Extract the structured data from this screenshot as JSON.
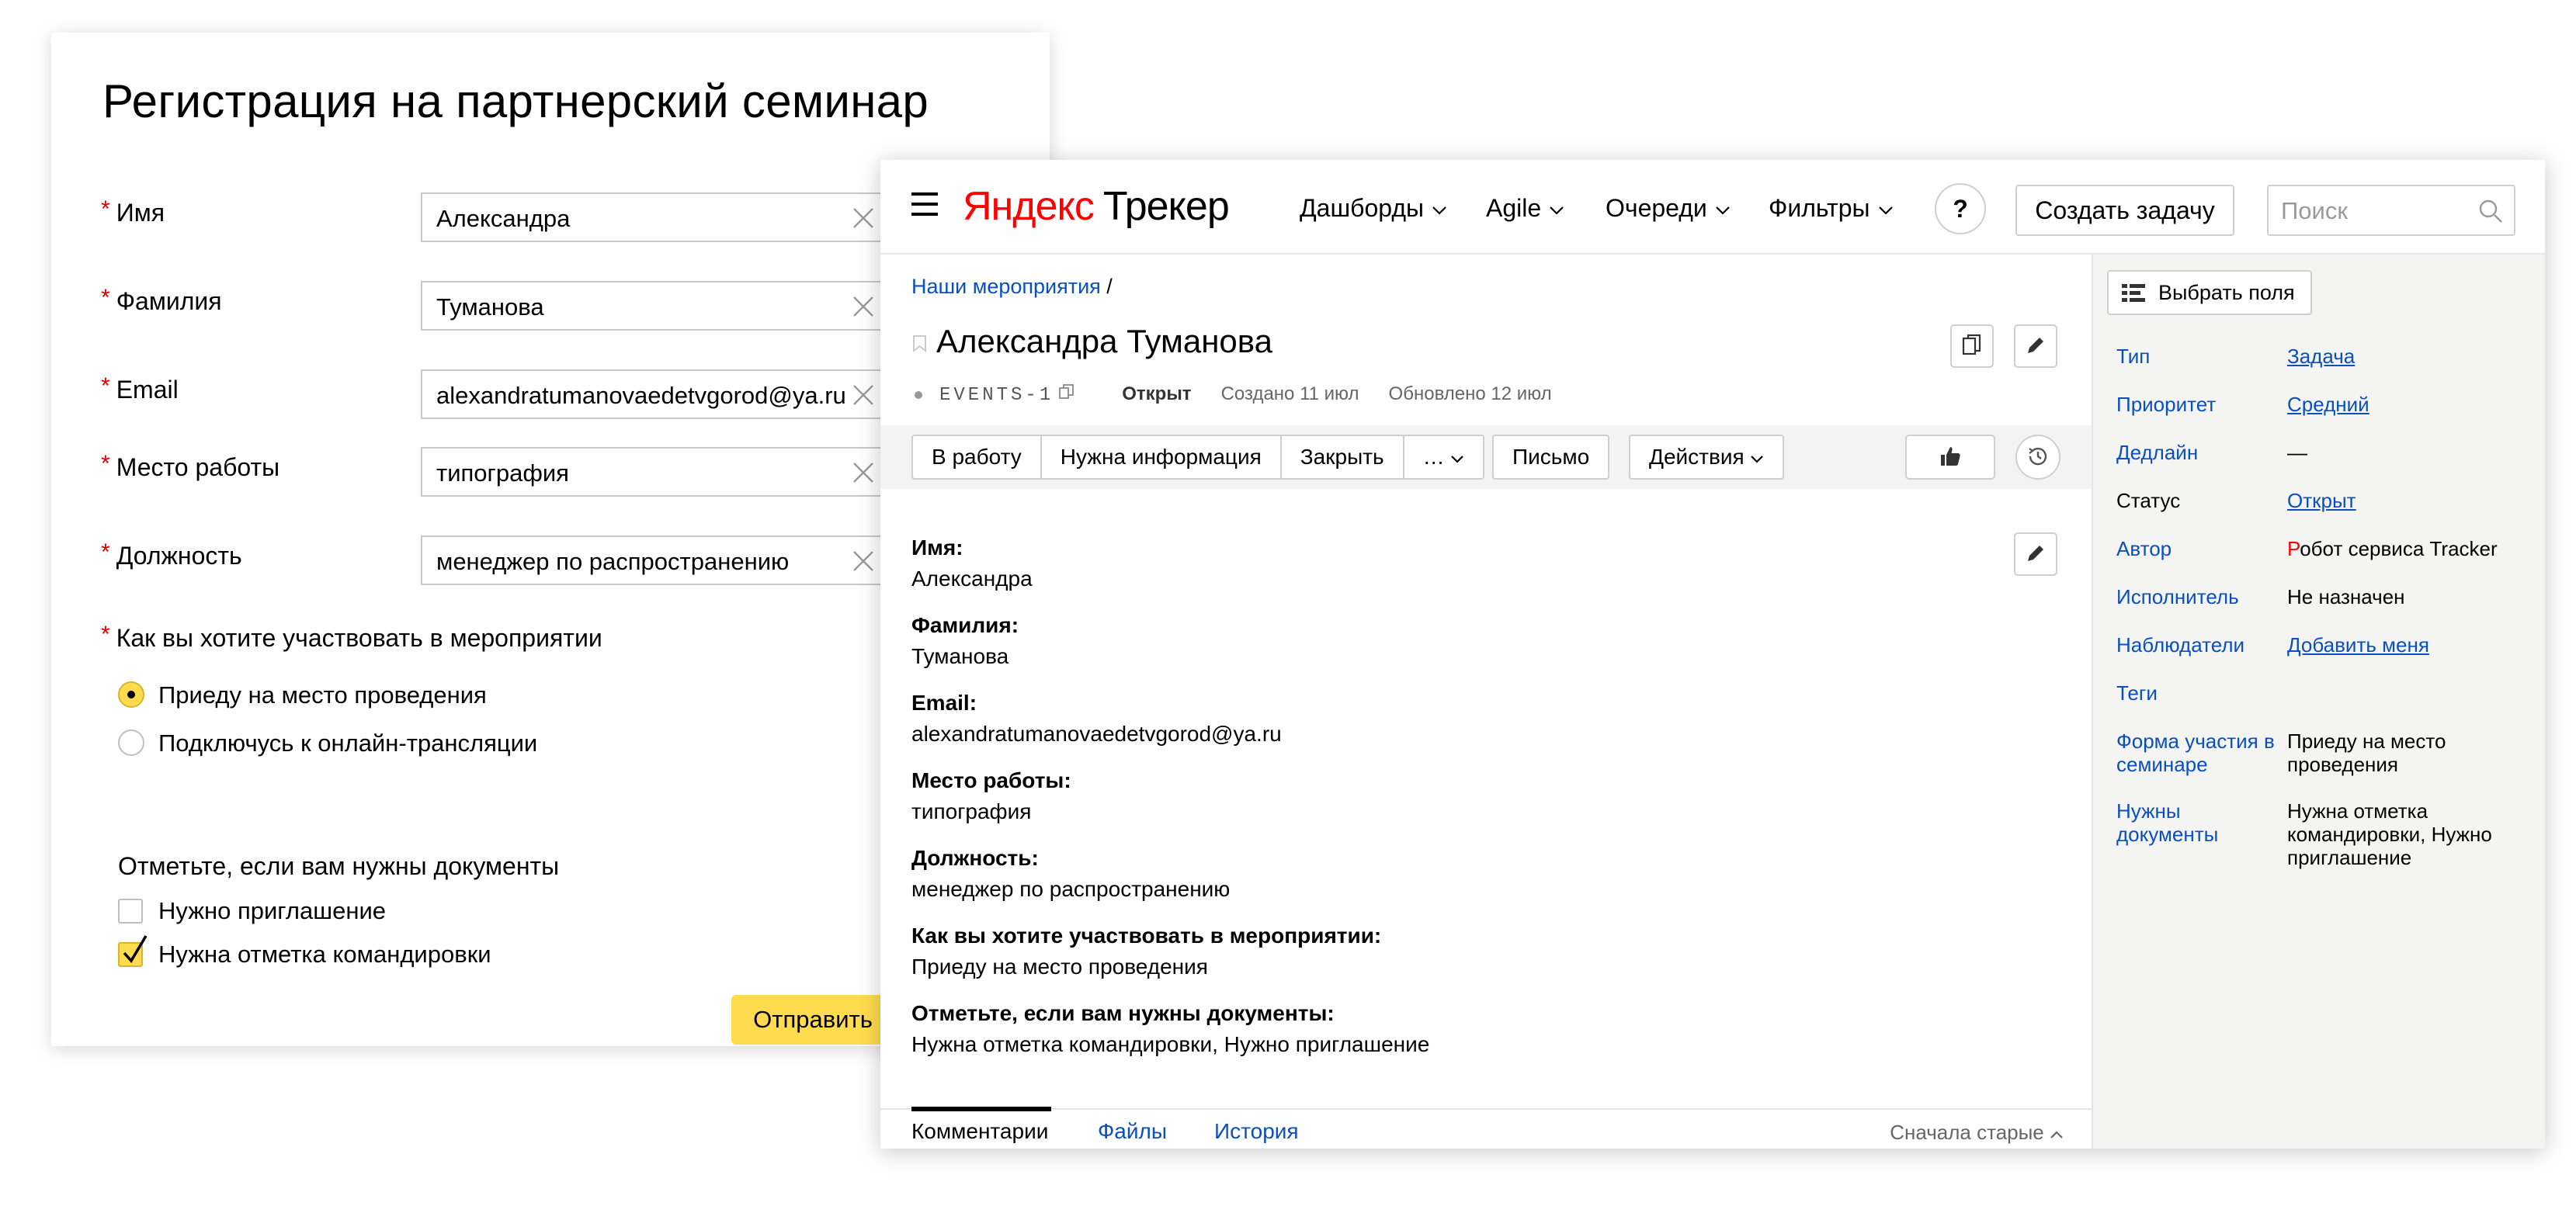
{
  "form": {
    "title": "Регистрация на партнерский семинар",
    "required_mark": "*",
    "fields": [
      {
        "label": "Имя",
        "value": "Александра"
      },
      {
        "label": "Фамилия",
        "value": "Туманова"
      },
      {
        "label": "Email",
        "value": "alexandratumanovaedetvgorod@ya.ru"
      },
      {
        "label": "Место работы",
        "value": "типография"
      },
      {
        "label": "Должность",
        "value": "менеджер по распространению"
      }
    ],
    "participation": {
      "question": "Как вы хотите участвовать в мероприятии",
      "options": [
        "Приеду на место проведения",
        "Подключусь к онлайн-трансляции"
      ],
      "selected": "Приеду на место проведения"
    },
    "documents": {
      "question": "Отметьте, если вам нужны документы",
      "options": [
        {
          "label": "Нужно приглашение",
          "checked": false
        },
        {
          "label": "Нужна отметка командировки",
          "checked": true
        }
      ]
    },
    "submit_label": "Отправить"
  },
  "tracker": {
    "logo_yandex": "Яндекс",
    "logo_product": "Трекер",
    "nav": [
      "Дашборды",
      "Agile",
      "Очереди",
      "Фильтры"
    ],
    "help_label": "?",
    "create_task_label": "Создать задачу",
    "search_placeholder": "Поиск",
    "breadcrumb": {
      "link": "Наши мероприятия",
      "separator": " /"
    },
    "issue": {
      "title": "Александра Туманова",
      "key": "EVENTS-1",
      "status": "Открыт",
      "created": "Создано 11 июл",
      "updated": "Обновлено 12 июл"
    },
    "actions": {
      "group": [
        "В работу",
        "Нужна информация",
        "Закрыть"
      ],
      "more": "…",
      "letter": "Письмо",
      "menu": "Действия"
    },
    "fields": [
      {
        "label": "Имя:",
        "value": "Александра"
      },
      {
        "label": "Фамилия:",
        "value": "Туманова"
      },
      {
        "label": "Email:",
        "value": "alexandratumanovaedetvgorod@ya.ru"
      },
      {
        "label": "Место работы:",
        "value": "типография"
      },
      {
        "label": "Должность:",
        "value": "менеджер по распространению"
      },
      {
        "label": "Как вы хотите участвовать в мероприятии:",
        "value": "Приеду на место проведения"
      },
      {
        "label": "Отметьте, если вам нужны документы:",
        "value": "Нужна отметка командировки, Нужно приглашение"
      }
    ],
    "tabs": [
      "Комментарии",
      "Файлы",
      "История"
    ],
    "sort_label": "Сначала старые",
    "sidebar": {
      "choose_fields_label": "Выбрать поля",
      "rows": [
        {
          "key": "Тип",
          "value": "Задача"
        },
        {
          "key": "Приоритет",
          "value": "Средний"
        },
        {
          "key": "Дедлайн",
          "value": "—"
        },
        {
          "key": "Статус",
          "value": "Открыт"
        },
        {
          "key": "Автор",
          "value_first": "Р",
          "value_rest": "обот сервиса Tracker"
        },
        {
          "key": "Исполнитель",
          "value": "Не назначен"
        },
        {
          "key": "Наблюдатели",
          "value": "Добавить меня"
        },
        {
          "key": "Теги",
          "value": ""
        },
        {
          "key": "Форма участия в семинаре",
          "value": "Приеду на место проведения"
        },
        {
          "key": "Нужны документы",
          "value": "Нужна отметка командировки, Нужно приглашение"
        }
      ]
    }
  },
  "colors": {
    "accent_yellow": "#ffdb4d",
    "link_blue": "#0a4fbe",
    "required_red": "#e00000",
    "logo_red": "#ff0000"
  }
}
